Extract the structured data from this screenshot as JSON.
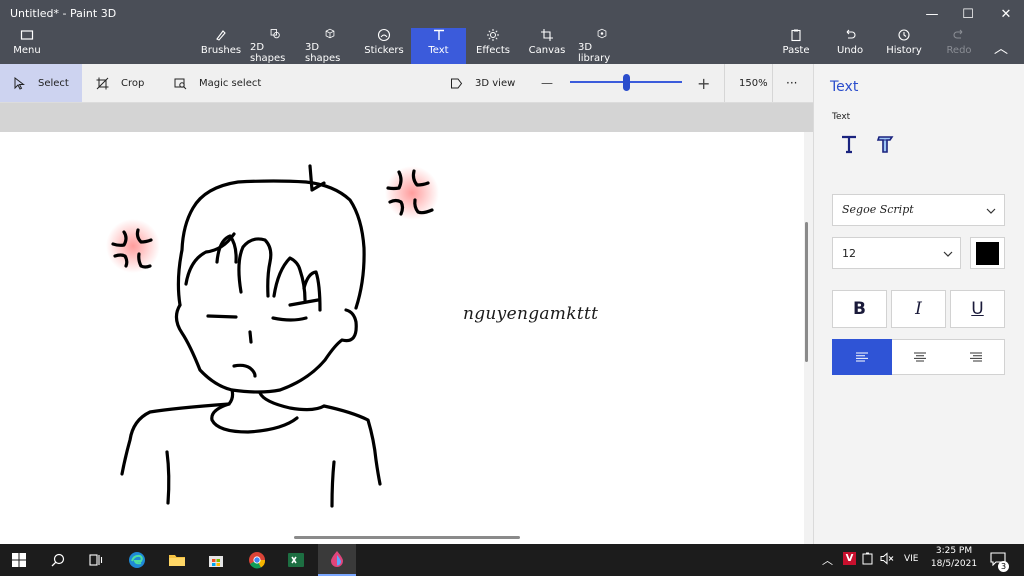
{
  "window": {
    "title": "Untitled* - Paint 3D",
    "minimize": "—",
    "maximize": "☐",
    "close": "✕"
  },
  "ribbon": {
    "menu": "Menu",
    "tabs": [
      {
        "label": "Brushes"
      },
      {
        "label": "2D shapes"
      },
      {
        "label": "3D shapes"
      },
      {
        "label": "Stickers"
      },
      {
        "label": "Text"
      },
      {
        "label": "Effects"
      },
      {
        "label": "Canvas"
      },
      {
        "label": "3D library"
      }
    ],
    "paste": "Paste",
    "undo": "Undo",
    "history": "History",
    "redo": "Redo",
    "collapse": "︿"
  },
  "toolbar": {
    "select": "Select",
    "crop": "Crop",
    "magic_select": "Magic select",
    "view3d": "3D view",
    "zoom_minus": "—",
    "zoom_plus": "+",
    "zoom_level": "150%",
    "zoom_fraction": 0.5,
    "more": "···"
  },
  "canvas": {
    "text": "nguyengamkttt"
  },
  "panel": {
    "title": "Text",
    "section": "Text",
    "font": "Segoe Script",
    "size": "12",
    "color": "#000000",
    "bold": "B",
    "italic": "I",
    "underline": "U"
  },
  "taskbar": {
    "lang": "VIE",
    "time": "3:25 PM",
    "date": "18/5/2021",
    "notifications": "3"
  },
  "colors": {
    "accent": "#3b5bdb",
    "ribbon": "#4a4e57",
    "taskbar": "#1c1c1c"
  }
}
